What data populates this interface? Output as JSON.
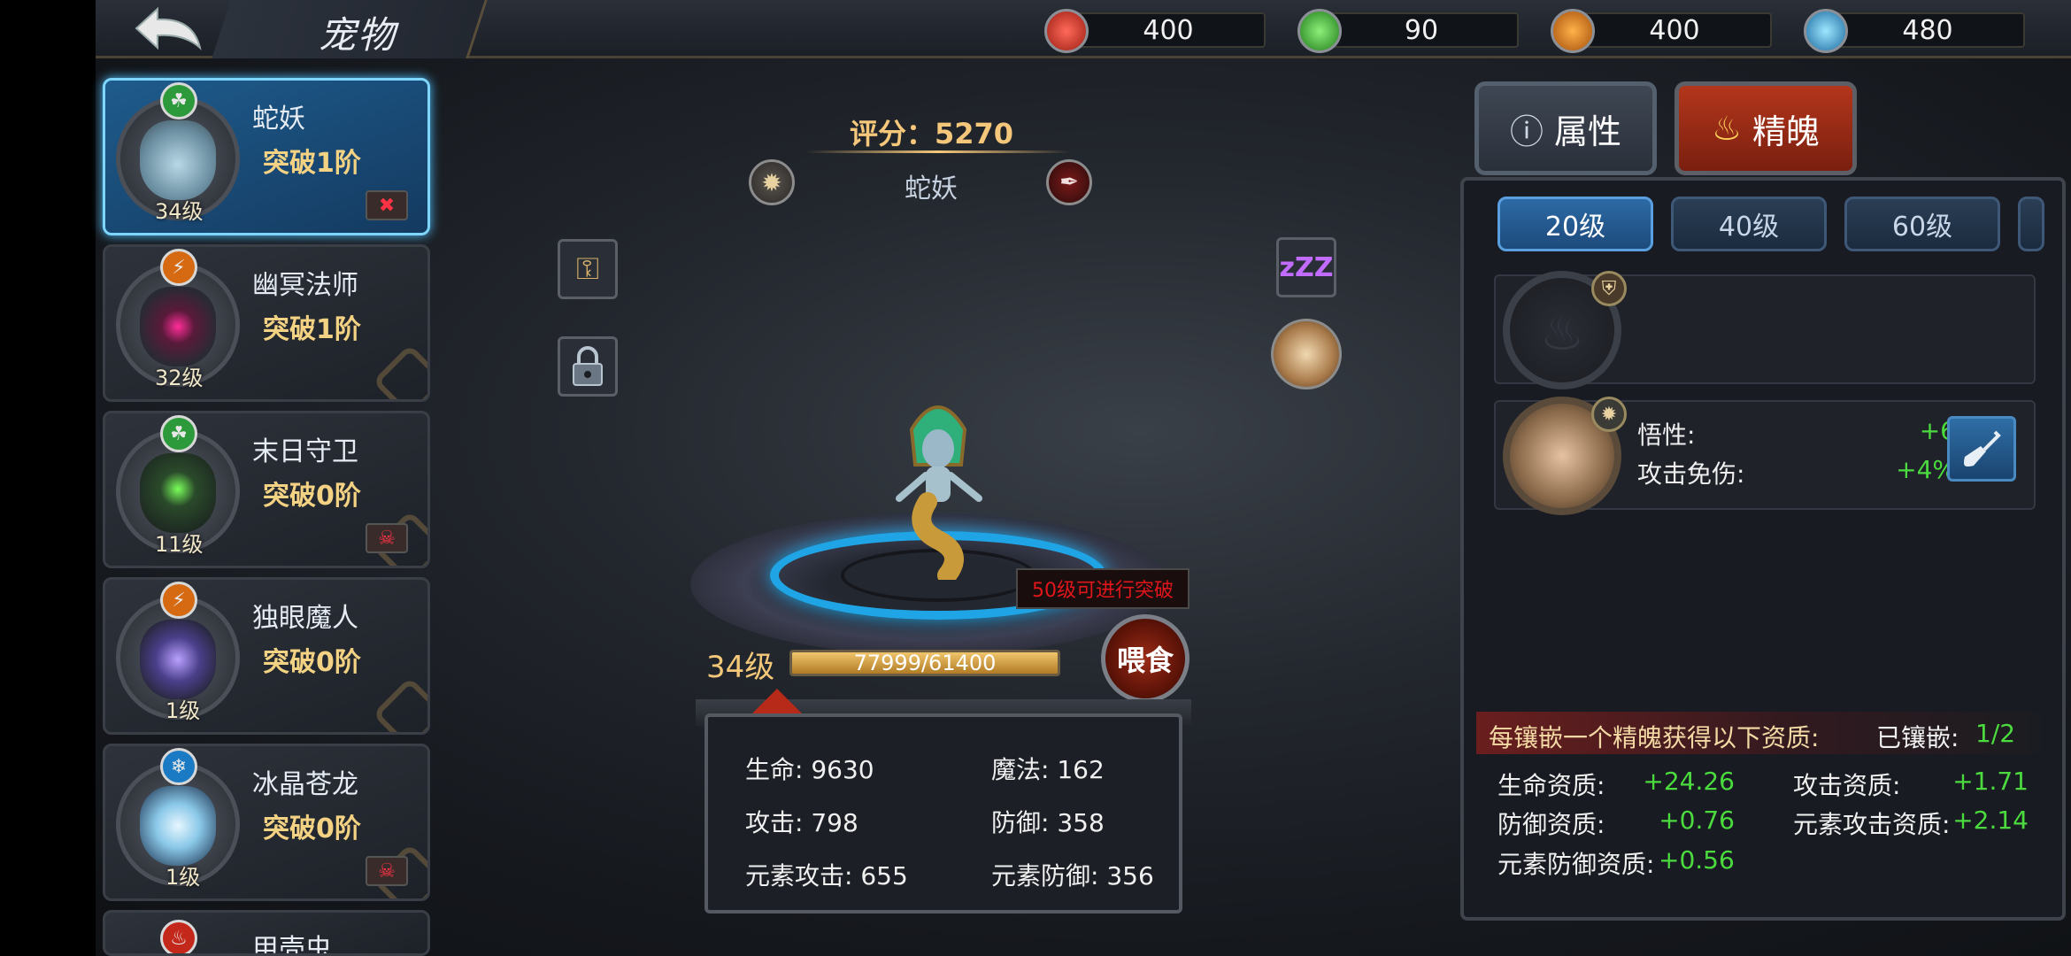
{
  "header": {
    "title": "宠物"
  },
  "resources": [
    {
      "name": "red-gem",
      "color": "#d63a2b",
      "value": "400"
    },
    {
      "name": "green-gem",
      "color": "#3fae3a",
      "value": "90"
    },
    {
      "name": "orange-gem",
      "color": "#e07a1c",
      "value": "400"
    },
    {
      "name": "blue-gem",
      "color": "#2a9fe0",
      "value": "480"
    }
  ],
  "pets": [
    {
      "name": "蛇妖",
      "break": "突破1阶",
      "level": "34级",
      "element": "green",
      "face": "#6aa3b8"
    },
    {
      "name": "幽冥法师",
      "break": "突破1阶",
      "level": "32级",
      "element": "orange",
      "face": "#8a2a5a"
    },
    {
      "name": "末日守卫",
      "break": "突破0阶",
      "level": "11级",
      "element": "green",
      "face": "#3a5a3a"
    },
    {
      "name": "独眼魔人",
      "break": "突破0阶",
      "level": "1级",
      "element": "orange",
      "face": "#4a4a8a"
    },
    {
      "name": "冰晶苍龙",
      "break": "突破0阶",
      "level": "1级",
      "element": "blue",
      "face": "#8ac8e8"
    },
    {
      "name": "甲壳虫",
      "element": "red"
    }
  ],
  "center": {
    "score": "评分：5270",
    "pet_name": "蛇妖",
    "level": "34级",
    "exp_text": "77999/61400",
    "exp_fraction": 1.0,
    "break_tip": "50级可进行突破",
    "feed": "喂食"
  },
  "stats": {
    "hp": "生命: 9630",
    "mp": "魔法: 162",
    "atk": "攻击: 798",
    "def": "防御: 358",
    "eatk": "元素攻击: 655",
    "edef": "元素防御: 356"
  },
  "right": {
    "tab_attr": "属性",
    "tab_soul": "精魄",
    "level_tabs": [
      "20级",
      "40级",
      "60级"
    ],
    "slot2": {
      "label1": "悟性:",
      "val1": "+6",
      "label2": "攻击免伤:",
      "val2": "+4%"
    },
    "bonus_title": "每镶嵌一个精魄获得以下资质:",
    "inlay_label": "已镶嵌:",
    "inlay_value": "1/2",
    "aptitudes": [
      {
        "label": "生命资质:",
        "value": "+24.26"
      },
      {
        "label": "攻击资质:",
        "value": "+1.71"
      },
      {
        "label": "防御资质:",
        "value": "+0.76"
      },
      {
        "label": "元素攻击资质:",
        "value": "+2.14"
      },
      {
        "label": "元素防御资质:",
        "value": "+0.56"
      }
    ]
  }
}
